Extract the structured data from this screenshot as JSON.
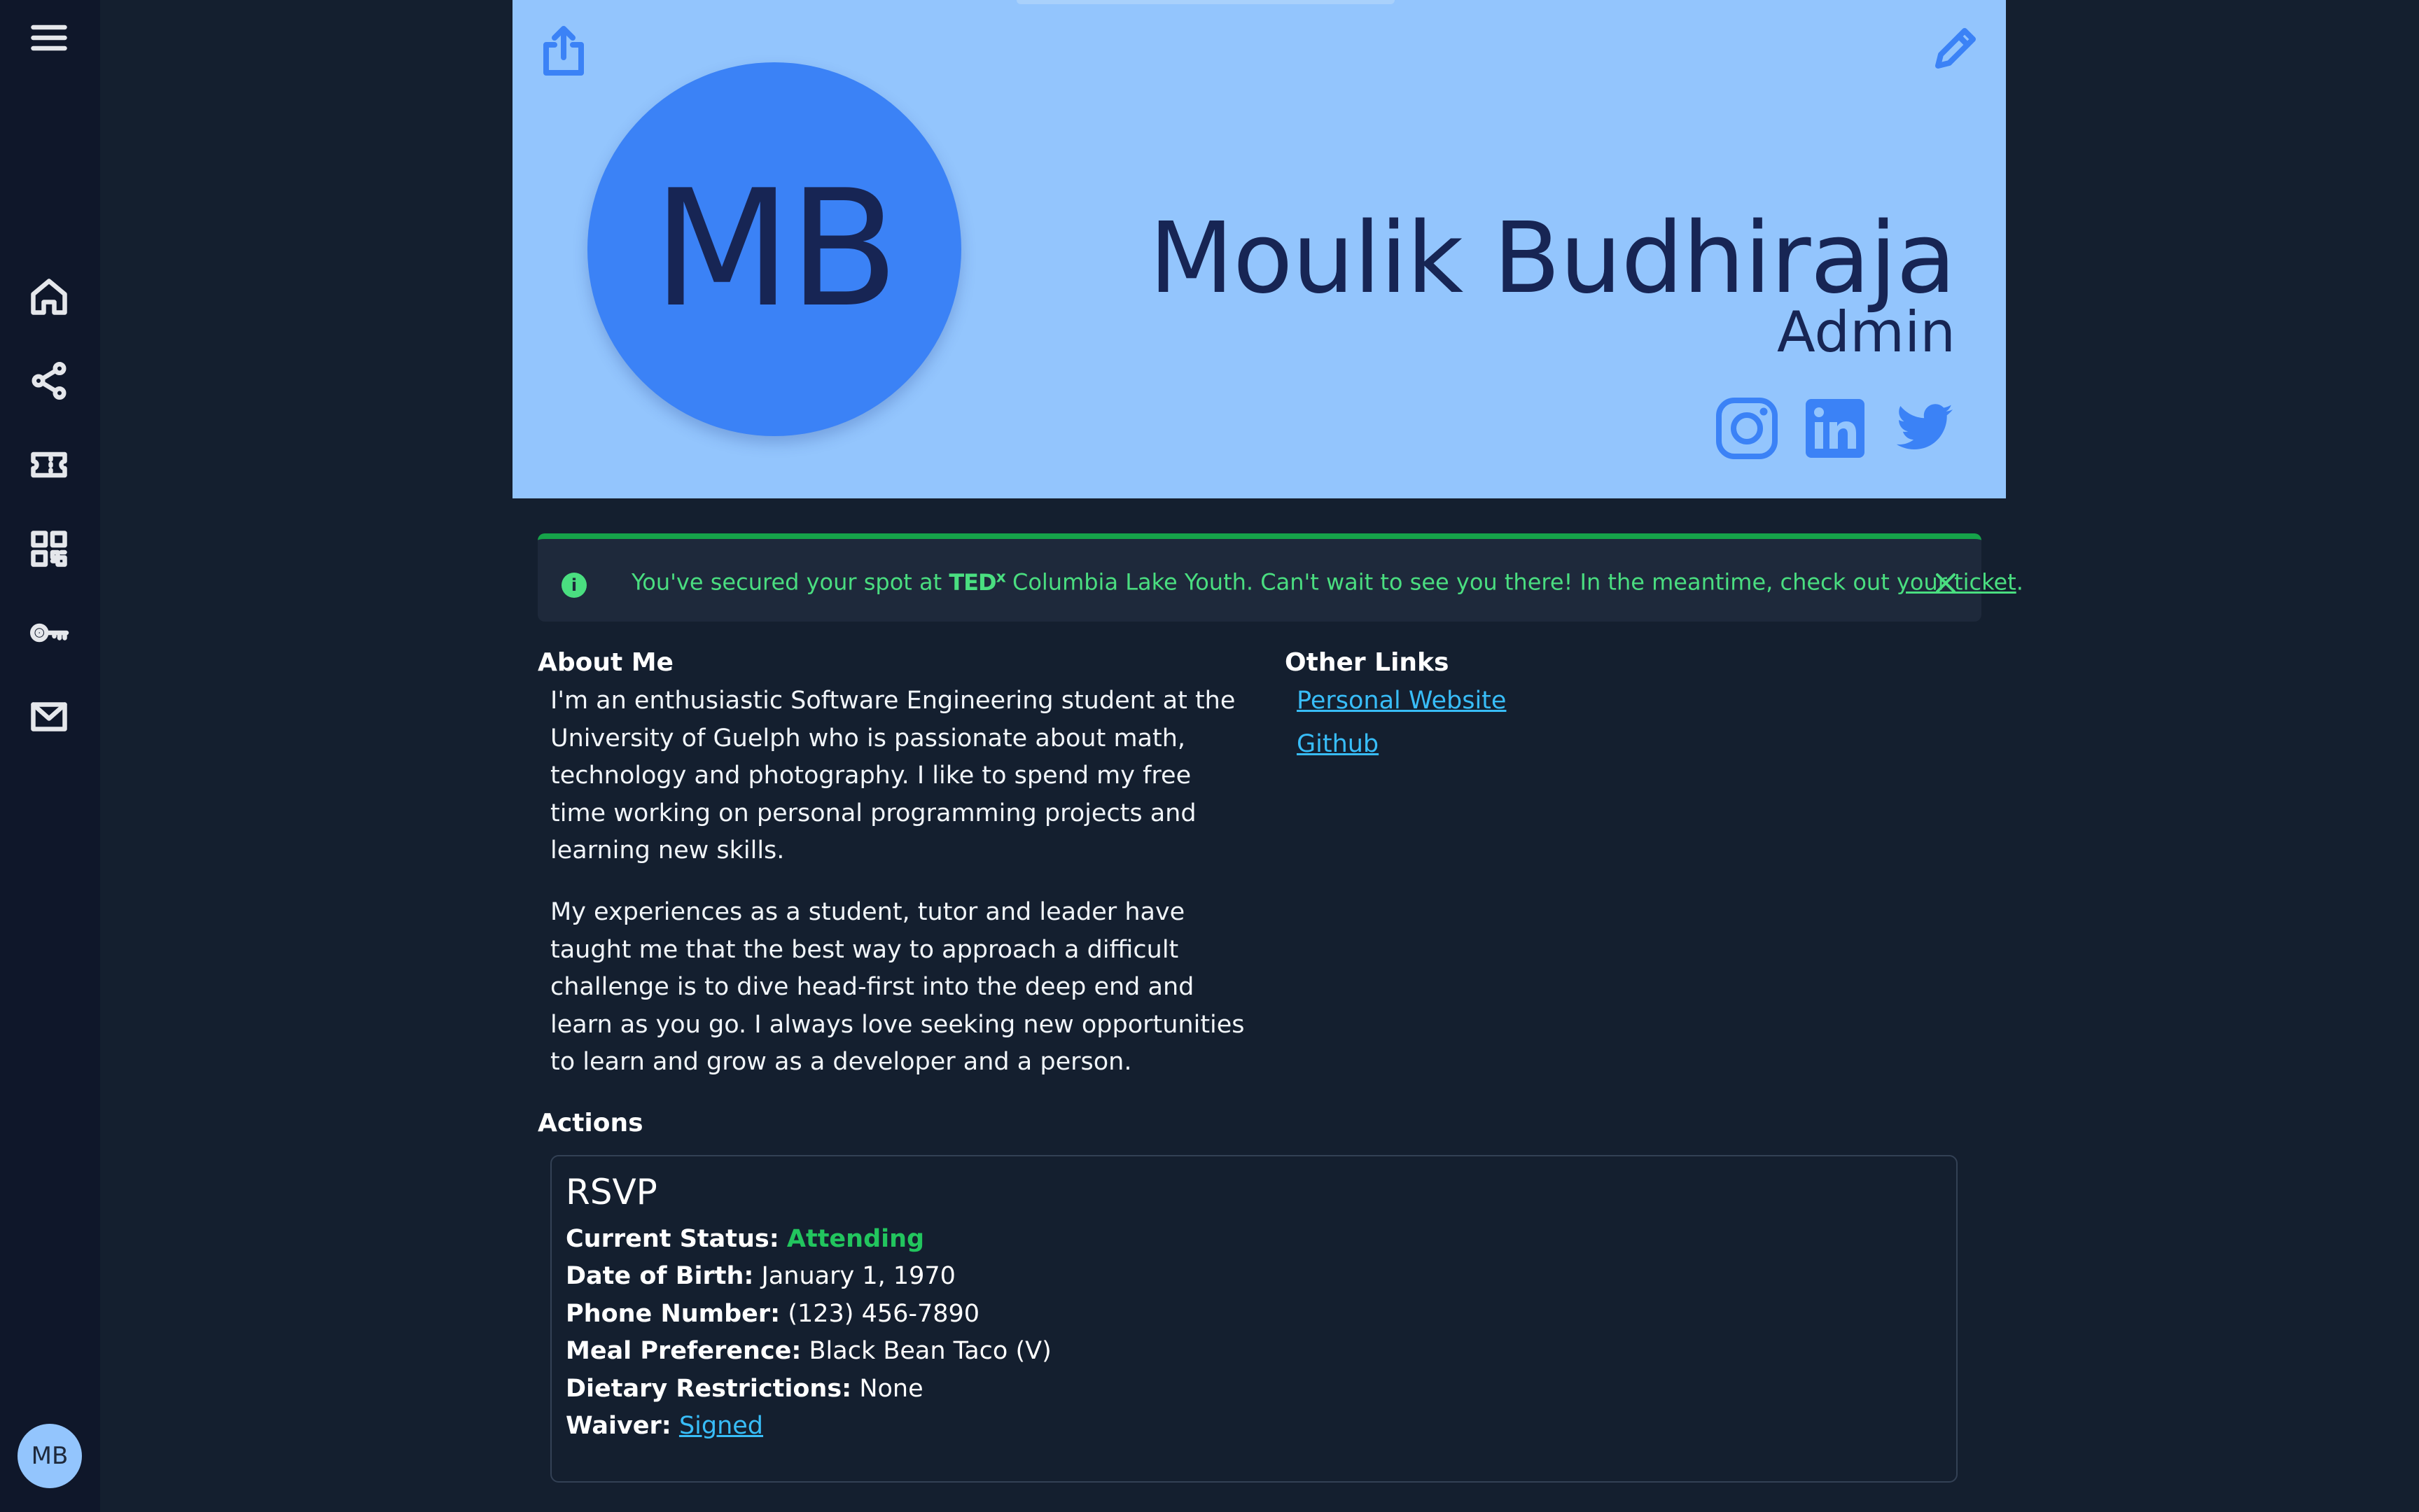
{
  "sidebar": {
    "avatar_initials": "MB",
    "items": [
      {
        "icon": "menu-icon"
      },
      {
        "icon": "home-icon"
      },
      {
        "icon": "share-network-icon"
      },
      {
        "icon": "ticket-icon"
      },
      {
        "icon": "qr-code-icon"
      },
      {
        "icon": "key-icon"
      },
      {
        "icon": "mail-icon"
      }
    ]
  },
  "profile": {
    "initials": "MB",
    "name": "Moulik Budhiraja",
    "role": "Admin",
    "socials": [
      "instagram-icon",
      "linkedin-icon",
      "twitter-icon"
    ],
    "colors": {
      "header_bg": "#93c5fd",
      "avatar_bg": "#3b82f6",
      "text": "#172554"
    }
  },
  "alert": {
    "prefix": "You've secured your spot at ",
    "brand": "TED",
    "brand_sup": "x",
    "middle": " Columbia Lake Youth. Can't wait to see you there! In the meantime, check out ",
    "link": "your ticket",
    "suffix": ".",
    "color": "#4ade80"
  },
  "about": {
    "title": "About Me",
    "paragraphs": [
      "I'm an enthusiastic Software Engineering student at the University of Guelph who is passionate about math, technology and photography. I like to spend my free time working on personal programming projects and learning new skills.",
      "My experiences as a student, tutor and leader have taught me that the best way to approach a difficult challenge is to dive head-first into the deep end and learn as you go. I always love seeking new opportunities to learn and grow as a developer and a person."
    ]
  },
  "other_links": {
    "title": "Other Links",
    "items": [
      "Personal Website",
      "Github"
    ]
  },
  "actions": {
    "title": "Actions",
    "rsvp": {
      "title": "RSVP",
      "status_label": "Current Status:",
      "status_value": "Attending",
      "dob_label": "Date of Birth:",
      "dob_value": "January 1, 1970",
      "phone_label": "Phone Number:",
      "phone_value": "(123) 456-7890",
      "meal_label": "Meal Preference:",
      "meal_value": "Black Bean Taco (V)",
      "diet_label": "Dietary Restrictions:",
      "diet_value": "None",
      "waiver_label": "Waiver:",
      "waiver_value": "Signed"
    }
  }
}
